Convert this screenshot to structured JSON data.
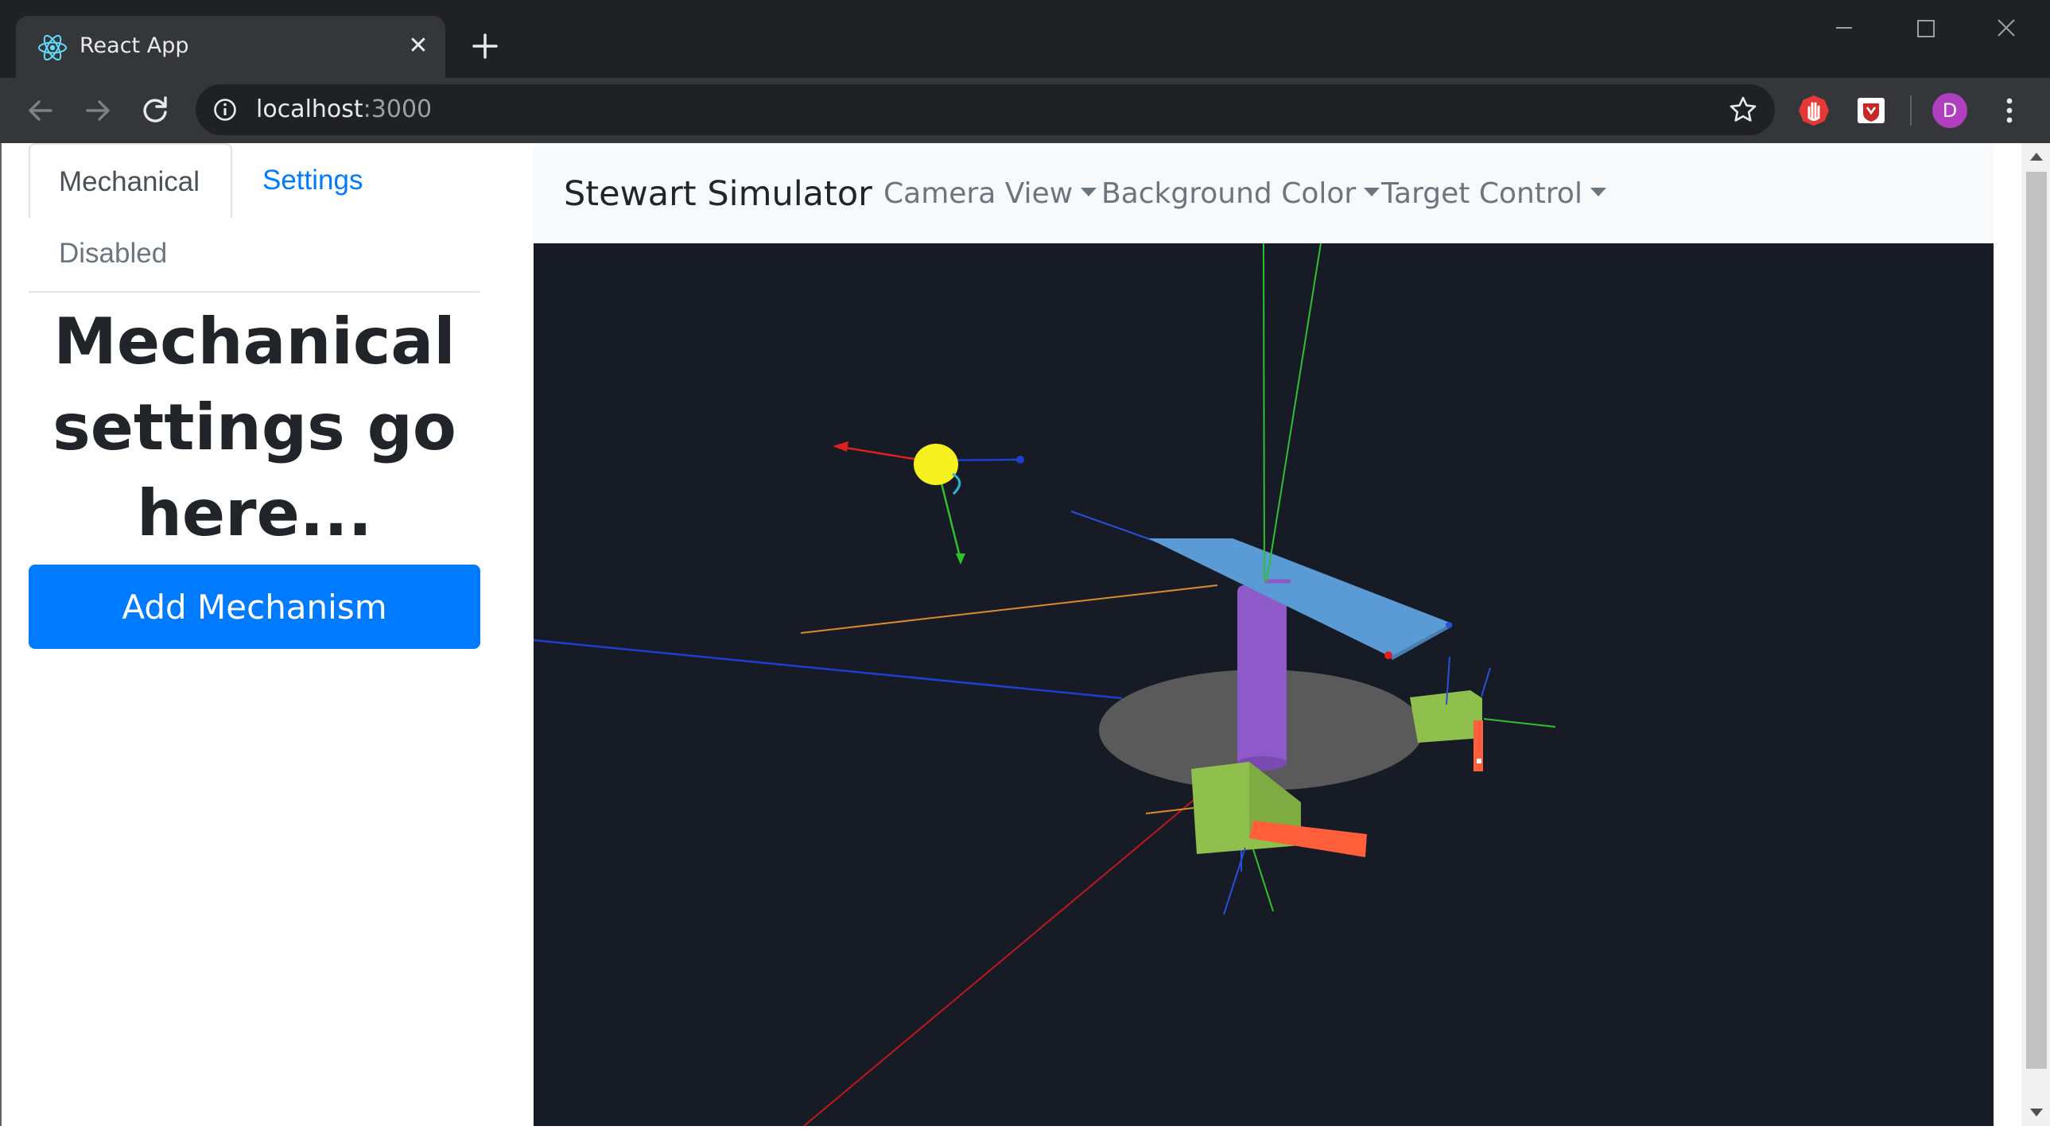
{
  "browser": {
    "tab_title": "React App",
    "tab_close_glyph": "✕",
    "url_host": "localhost",
    "url_port": ":3000",
    "profile_initial": "D",
    "icons": {
      "favicon": "react-logo-icon",
      "new_tab": "plus-icon",
      "back": "arrow-left-icon",
      "forward": "arrow-right-icon",
      "reload": "reload-icon",
      "site_info": "info-icon",
      "bookmark": "star-icon",
      "extension_1": "stop-hand-icon",
      "extension_2": "shield-extension-icon",
      "menu": "vertical-dots-icon",
      "minimize": "minimize-icon",
      "maximize": "maximize-icon",
      "close": "close-icon"
    }
  },
  "sidebar": {
    "tabs": [
      {
        "label": "Mechanical",
        "state": "active"
      },
      {
        "label": "Settings",
        "state": "link"
      },
      {
        "label": "Disabled",
        "state": "disabled"
      }
    ],
    "heading": "Mechanical settings go here...",
    "add_button": "Add Mechanism"
  },
  "navbar": {
    "brand": "Stewart Simulator",
    "menus": [
      {
        "label": "Camera View"
      },
      {
        "label": "Background Color"
      },
      {
        "label": "Target Control"
      }
    ]
  },
  "colors": {
    "chrome_dark": "#202124",
    "chrome_mid": "#35363a",
    "primary": "#007bff",
    "scene_bg": "#161b26",
    "platform": "#5b9bd5",
    "base": "#5a5a5a",
    "actuator_column": "#8e59c8",
    "servo_body": "#8fc04d",
    "servo_arm": "#ff5f3a",
    "target": "#f6f01f"
  }
}
